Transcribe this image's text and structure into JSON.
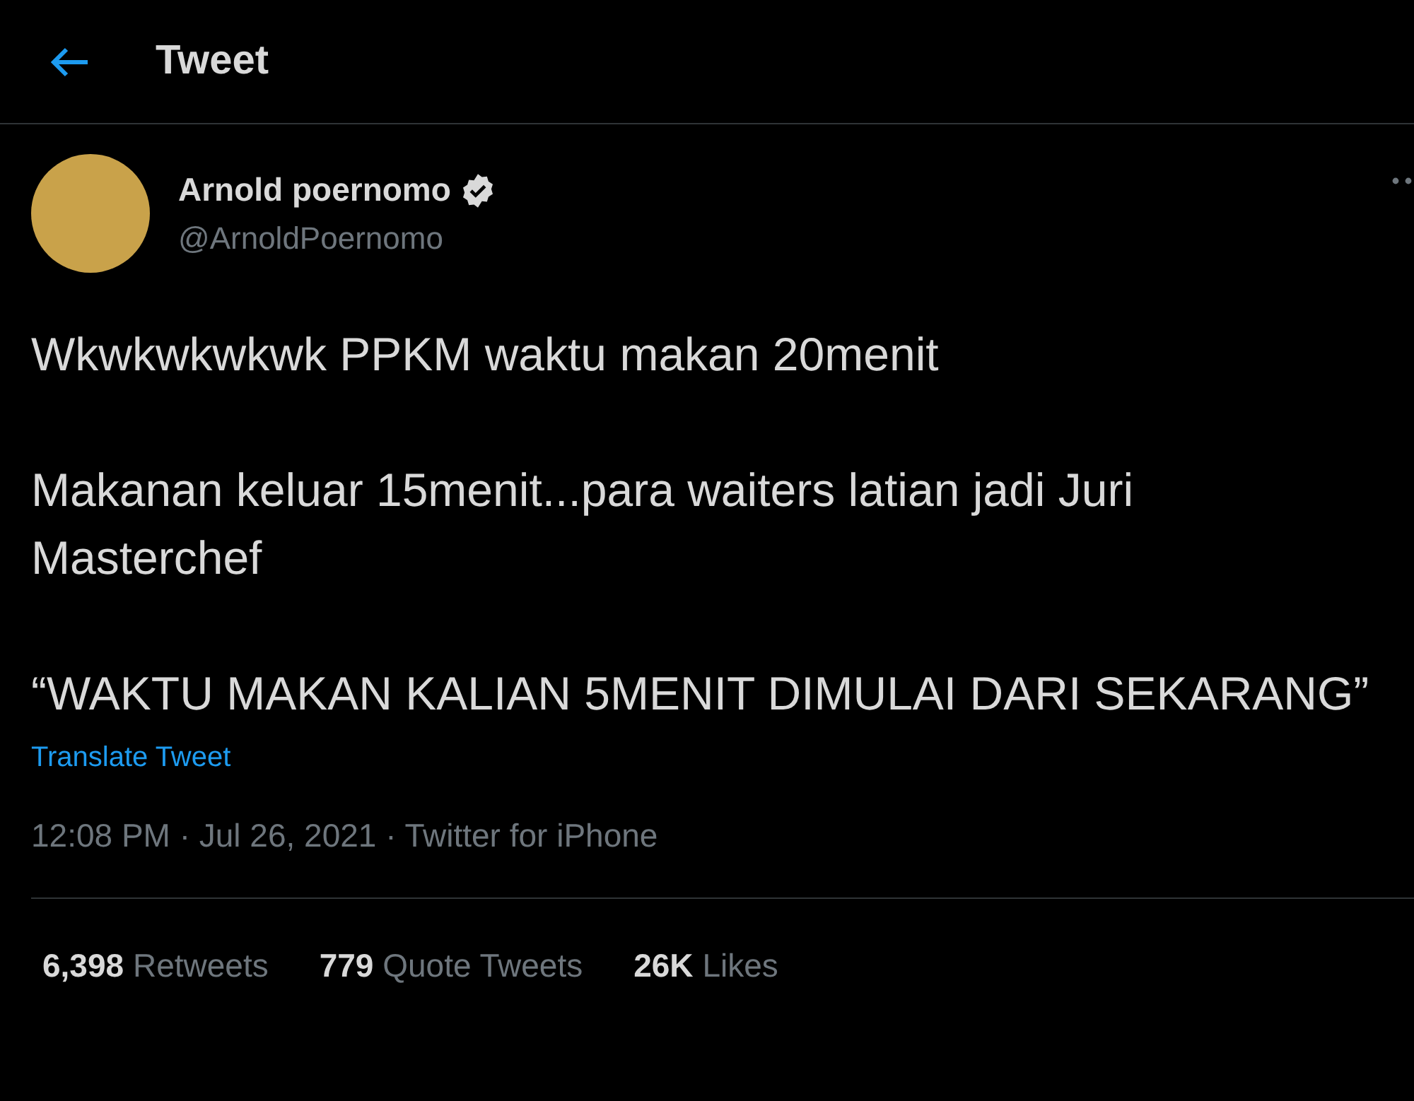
{
  "header": {
    "title": "Tweet"
  },
  "author": {
    "name": "Arnold poernomo",
    "verified": true,
    "handle": "@ArnoldPoernomo"
  },
  "tweet": {
    "paragraphs": [
      "Wkwkwkwkwk PPKM waktu makan 20menit",
      "Makanan keluar 15menit...para waiters latian jadi Juri Masterchef",
      "“WAKTU MAKAN KALIAN 5MENIT DIMULAI DARI SEKARANG”"
    ],
    "translate_link": "Translate Tweet",
    "meta": "12:08 PM · Jul 26, 2021 · Twitter for iPhone"
  },
  "stats": [
    {
      "count": "6,398",
      "label": "Retweets"
    },
    {
      "count": "779",
      "label": "Quote Tweets"
    },
    {
      "count": "26K",
      "label": "Likes"
    }
  ]
}
